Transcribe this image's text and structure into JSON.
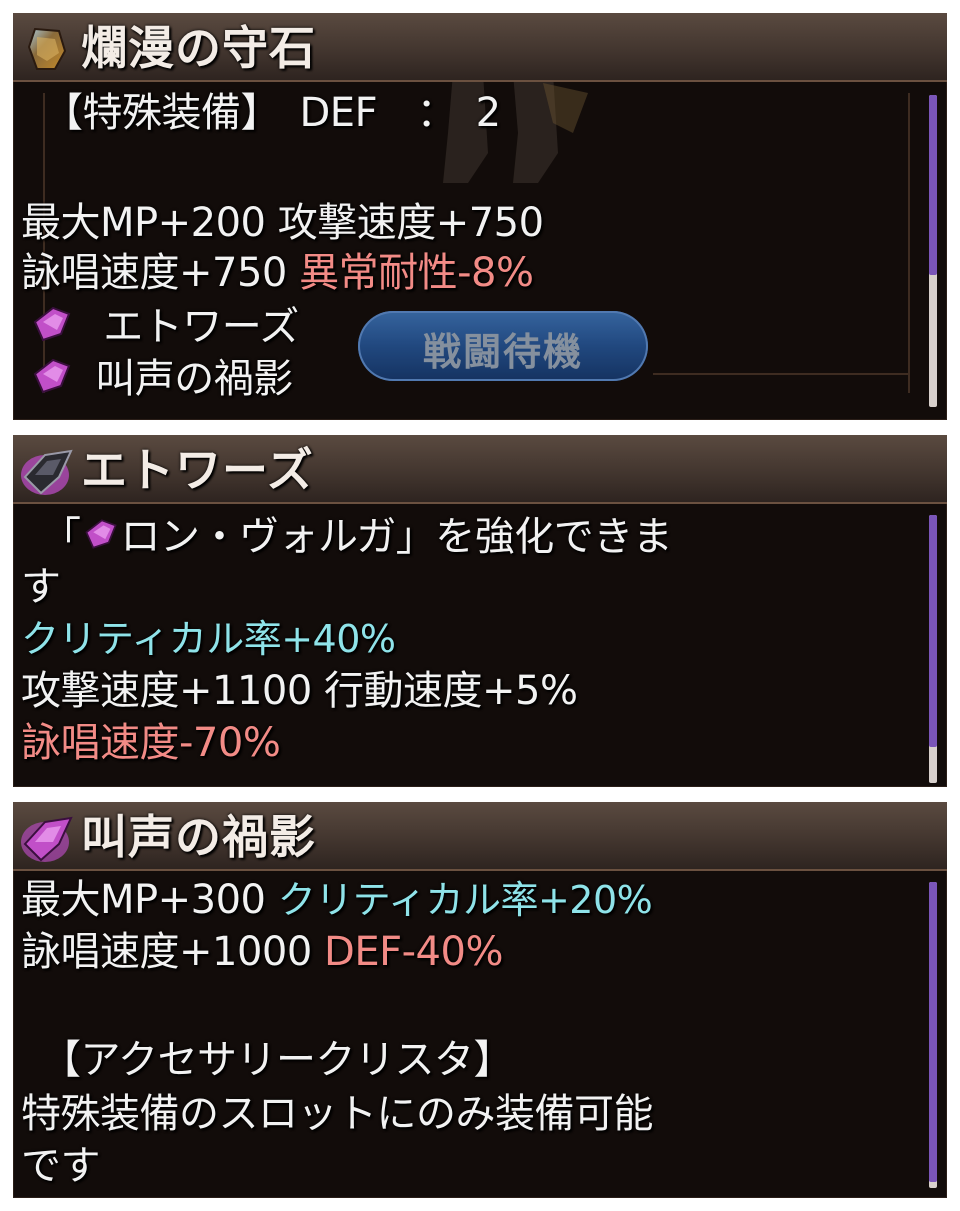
{
  "panels": [
    {
      "title": "爛漫の守石",
      "icon": "amber-stone-icon",
      "lines": [
        {
          "segments": [
            {
              "text": "【特殊装備】　DEF　：　2",
              "color": "white"
            }
          ]
        },
        {
          "segments": [
            {
              "text": "",
              "color": "white"
            }
          ]
        },
        {
          "segments": [
            {
              "text": "最大MP+200  攻撃速度+750",
              "color": "white"
            }
          ]
        },
        {
          "segments": [
            {
              "text": "詠唱速度+750 ",
              "color": "white"
            },
            {
              "text": "異常耐性-8%",
              "color": "pink"
            }
          ]
        },
        {
          "segments": [
            {
              "text": "エトワーズ",
              "color": "white"
            }
          ],
          "gem": "purple-crystal-icon"
        },
        {
          "segments": [
            {
              "text": "叫声の禍影",
              "color": "white"
            }
          ],
          "gem": "purple-crystal-icon"
        }
      ],
      "button": "戦闘待機"
    },
    {
      "title": "エトワーズ",
      "icon": "dark-crystal-icon",
      "lines": [
        {
          "segments": [
            {
              "text": "「",
              "color": "white"
            },
            {
              "text": "ロン・ヴォルガ」を強化できま",
              "color": "white"
            }
          ],
          "inline_gem": "purple-crystal-icon"
        },
        {
          "segments": [
            {
              "text": "す",
              "color": "white"
            }
          ]
        },
        {
          "segments": [
            {
              "text": "クリティカル率+40%",
              "color": "cyan"
            }
          ]
        },
        {
          "segments": [
            {
              "text": "攻撃速度+1100  行動速度+5%",
              "color": "white"
            }
          ]
        },
        {
          "segments": [
            {
              "text": "詠唱速度-70%",
              "color": "pink"
            }
          ]
        }
      ]
    },
    {
      "title": "叫声の禍影",
      "icon": "purple-crystal-icon",
      "lines": [
        {
          "segments": [
            {
              "text": "最大MP+300  ",
              "color": "white"
            },
            {
              "text": "クリティカル率+20%",
              "color": "cyan"
            }
          ]
        },
        {
          "segments": [
            {
              "text": "詠唱速度+1000  ",
              "color": "white"
            },
            {
              "text": "DEF-40%",
              "color": "pink"
            }
          ]
        },
        {
          "segments": [
            {
              "text": "",
              "color": "white"
            }
          ]
        },
        {
          "segments": [
            {
              "text": "【アクセサリークリスタ】",
              "color": "white"
            }
          ]
        },
        {
          "segments": [
            {
              "text": "特殊装備のスロットにのみ装備可能",
              "color": "white"
            }
          ]
        },
        {
          "segments": [
            {
              "text": "です",
              "color": "white"
            }
          ]
        }
      ]
    }
  ],
  "colors": {
    "white": "#f2f2f2",
    "pink": "#f28b86",
    "cyan": "#8fe3e9",
    "scroll": "#7a55b8"
  }
}
